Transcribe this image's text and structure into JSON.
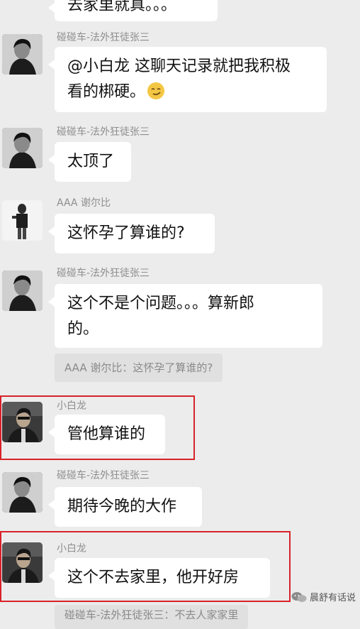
{
  "top_bubble_partial": "去家里就真。。。",
  "messages": [
    {
      "sender": "碰碰车-法外狂徒张三",
      "lines": [
        "@小白龙 这聊天记录就把我积极",
        "看的梆硬。"
      ],
      "emoji": "smirk-emoji"
    },
    {
      "sender": "碰碰车-法外狂徒张三",
      "lines": [
        "太顶了"
      ]
    },
    {
      "sender": "AAA 谢尔比",
      "lines": [
        "这怀孕了算谁的?"
      ]
    },
    {
      "sender": "碰碰车-法外狂徒张三",
      "lines": [
        "这个不是个问题。。。算新郎",
        "的。"
      ],
      "quote": "AAA 谢尔比：这怀孕了算谁的?"
    },
    {
      "sender": "小白龙",
      "lines": [
        "管他算谁的"
      ]
    },
    {
      "sender": "碰碰车-法外狂徒张三",
      "lines": [
        "期待今晚的大作"
      ]
    },
    {
      "sender": "小白龙",
      "lines": [
        "这个不去家里，他开好房"
      ]
    }
  ],
  "bottom_partial": "碰碰车-法外狂徒张三：不去人家家里",
  "watermark": "晨舒有话说",
  "colors": {
    "highlight": "#d8222a",
    "bubble": "#ffffff",
    "background": "#ececec"
  }
}
